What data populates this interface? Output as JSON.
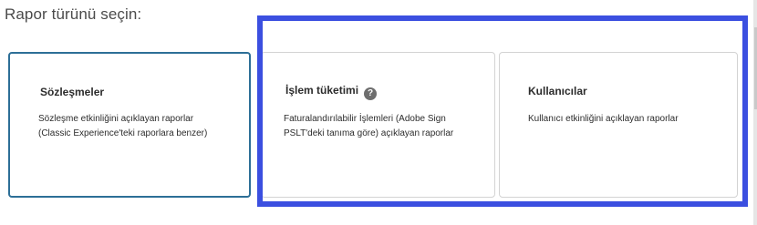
{
  "prompt": "Rapor türünü seçin:",
  "cards": [
    {
      "title": "Sözleşmeler",
      "desc_line1": "Sözleşme etkinliğini açıklayan raporlar",
      "desc_line2": "(Classic Experience'teki raporlara benzer)",
      "selected": true
    },
    {
      "title": "İşlem tüketimi",
      "desc_line1": "Faturalandırılabilir İşlemleri (Adobe Sign",
      "desc_line2": "PSLT'deki tanıma göre) açıklayan raporlar",
      "help_icon": "question-mark-icon",
      "help_glyph": "?",
      "selected": false
    },
    {
      "title": "Kullanıcılar",
      "desc_line1": "Kullanıcı etkinliğini açıklayan raporlar",
      "selected": false
    }
  ],
  "colors": {
    "selected_border": "#2d6f97",
    "highlight_frame": "#3b4fe0",
    "card_border": "#d3d3d3"
  }
}
